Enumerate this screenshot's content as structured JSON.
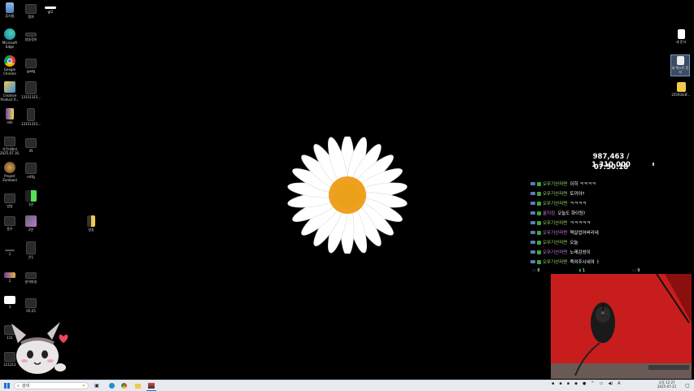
{
  "desktop": {
    "left_icons": [
      {
        "label": "휴지통",
        "kind": "recycle"
      },
      {
        "label": "캡처",
        "kind": "dark"
      },
      {
        "label": "gt2",
        "kind": "white"
      },
      {
        "label": "Microsoft Edge",
        "kind": "edge"
      },
      {
        "label": "방송정보",
        "kind": "dark"
      },
      {
        "label": "Google Chrome",
        "kind": "chrome"
      },
      {
        "label": "gadg",
        "kind": "dark"
      },
      {
        "label": "Creative Product R...",
        "kind": "creative"
      },
      {
        "label": "13151315...",
        "kind": "dark"
      },
      {
        "label": "aliti",
        "kind": "doc"
      },
      {
        "label": "13151315...",
        "kind": "dark"
      },
      {
        "label": "치킨대회자 2025.07.16...",
        "kind": "dark"
      },
      {
        "label": "45",
        "kind": "dark"
      },
      {
        "label": "Project Zomboid",
        "kind": "zomboid"
      },
      {
        "label": "ertfg",
        "kind": "dark"
      },
      {
        "label": "방송",
        "kind": "dark"
      },
      {
        "label": "1번",
        "kind": "green"
      },
      {
        "label": "동우",
        "kind": "dark"
      },
      {
        "label": "2번",
        "kind": "folder"
      },
      {
        "label": "방송",
        "kind": "folder-small"
      },
      {
        "label": "1",
        "kind": "dark"
      },
      {
        "label": "큰1",
        "kind": "dark"
      },
      {
        "label": "2",
        "kind": "dark"
      },
      {
        "label": "분석파일",
        "kind": "dark"
      },
      {
        "label": "3",
        "kind": "white"
      },
      {
        "label": "05:25",
        "kind": "dark"
      },
      {
        "label": "111",
        "kind": "dark"
      },
      {
        "label": "121212",
        "kind": "dark"
      }
    ],
    "right_icons": [
      {
        "label": "새 문서",
        "kind": "doc"
      },
      {
        "label": "새 텍스트 문서",
        "kind": "doc-selected"
      },
      {
        "label": "2559343F...",
        "kind": "folder"
      }
    ]
  },
  "overlay": {
    "counter": "987,463 / 1,310,000",
    "timer": "07:50:18"
  },
  "chat": {
    "messages": [
      {
        "nick": "오무기산라면",
        "text": "이히 ㅋㅋㅋㅋ",
        "color": "#9cd66b"
      },
      {
        "nick": "오무기산라면",
        "text": "토끼야?",
        "color": "#9cd66b"
      },
      {
        "nick": "오무기산라면",
        "text": "ㅋㅋㅋㅋ",
        "color": "#9cd66b"
      },
      {
        "nick": "꿀지킴",
        "text": "오늘도 화이팅!",
        "color": "#d07bd8"
      },
      {
        "nick": "오무기산라면",
        "text": "ㅋㅋㅋㅋㅋ",
        "color": "#9cd66b"
      },
      {
        "nick": "오무기산라면",
        "text": "역살업어버리네",
        "color": "#d07bd8"
      },
      {
        "nick": "오무기산라면",
        "text": "오늘",
        "color": "#9cd66b"
      },
      {
        "nick": "오무기산라면",
        "text": "노래감성이",
        "color": "#d07bd8"
      },
      {
        "nick": "오무기산라면",
        "text": "죽여주시네여 ㅏ",
        "color": "#9cd66b"
      }
    ],
    "stats": {
      "viewers": "8",
      "likes": "1",
      "subs": "9"
    }
  },
  "taskbar": {
    "search_placeholder": "검색",
    "time": "오후 12:27",
    "date": "2025-07-21",
    "lang": "A"
  },
  "colors": {
    "taskbar": "#e7ebf0",
    "cam_bg": "#c81d1d",
    "petal": "#ffffff",
    "flower_center": "#f0a020"
  }
}
